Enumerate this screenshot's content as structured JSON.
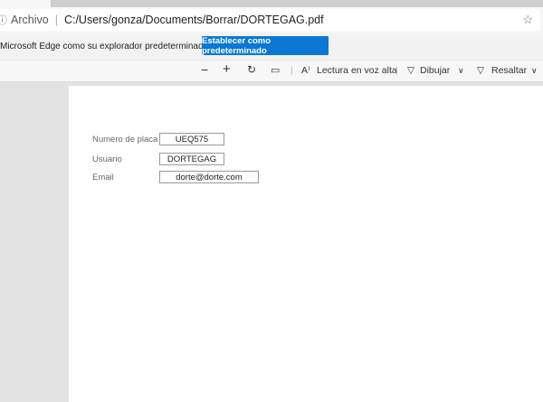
{
  "address_bar": {
    "label": "Archivo",
    "url": "C:/Users/gonza/Documents/Borrar/DORTEGAG.pdf"
  },
  "infobar": {
    "message": "Microsoft Edge como su explorador predeterminado?",
    "button": "Establecer como predeterminado"
  },
  "toolbar": {
    "read_aloud": "Lectura en voz alta",
    "draw": "Dibujar",
    "highlight": "Resaltar"
  },
  "form": {
    "fields": [
      {
        "label": "Numero de placa",
        "value": "UEQ575"
      },
      {
        "label": "Usuario",
        "value": "DORTEGAG"
      },
      {
        "label": "Email",
        "value": "dorte@dorte.com"
      }
    ]
  },
  "colors": {
    "accent": "#0a78d4"
  }
}
